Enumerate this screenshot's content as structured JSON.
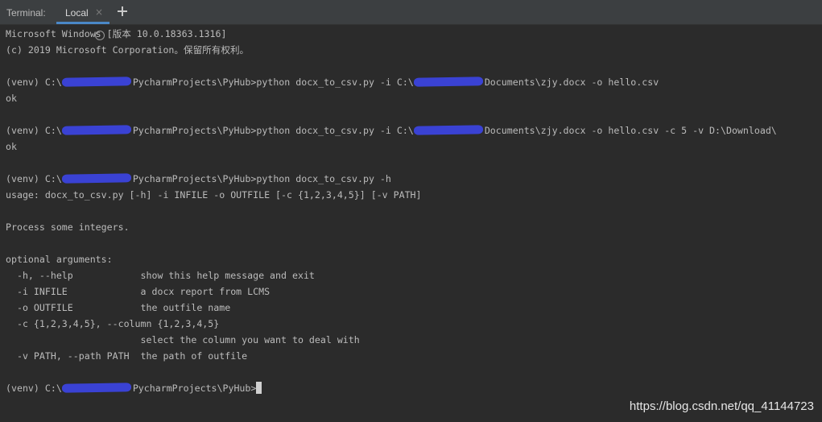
{
  "tabbar": {
    "label": "Terminal:",
    "active_tab": "Local",
    "close_glyph": "×",
    "add_icon": "plus-icon"
  },
  "terminal": {
    "lines": [
      {
        "text": "Microsoft Windows [版本 10.0.18363.1316]"
      },
      {
        "text": "(c) 2019 Microsoft Corporation。保留所有权利。"
      },
      {
        "text": ""
      },
      {
        "pre": "(venv) C:\\",
        "mid": "PycharmProjects\\PyHub>python docx_to_csv.py -i C:\\",
        "post": "Documents\\zjy.docx -o hello.csv"
      },
      {
        "text": "ok"
      },
      {
        "text": ""
      },
      {
        "pre": "(venv) C:\\",
        "mid": "PycharmProjects\\PyHub>python docx_to_csv.py -i C:\\",
        "post": "Documents\\zjy.docx -o hello.csv -c 5 -v D:\\Download\\"
      },
      {
        "text": "ok"
      },
      {
        "text": ""
      },
      {
        "pre": "(venv) C:\\",
        "mid": "PycharmProjects\\PyHub>python docx_to_csv.py -h"
      },
      {
        "text": "usage: docx_to_csv.py [-h] -i INFILE -o OUTFILE [-c {1,2,3,4,5}] [-v PATH]"
      },
      {
        "text": ""
      },
      {
        "text": "Process some integers."
      },
      {
        "text": ""
      },
      {
        "text": "optional arguments:"
      },
      {
        "text": "  -h, --help            show this help message and exit"
      },
      {
        "text": "  -i INFILE             a docx report from LCMS"
      },
      {
        "text": "  -o OUTFILE            the outfile name"
      },
      {
        "text": "  -c {1,2,3,4,5}, --column {1,2,3,4,5}"
      },
      {
        "text": "                        select the column you want to deal with"
      },
      {
        "text": "  -v PATH, --path PATH  the path of outfile"
      },
      {
        "text": ""
      },
      {
        "pre": "(venv) C:\\",
        "mid": "PycharmProjects\\PyHub>"
      }
    ]
  },
  "watermark": "https://blog.csdn.net/qq_41144723",
  "colors": {
    "background": "#2b2b2b",
    "tabbar": "#3c3f41",
    "text": "#bbbbbb",
    "active_tab_underline": "#4a88c7",
    "redaction": "#3a42d4"
  }
}
